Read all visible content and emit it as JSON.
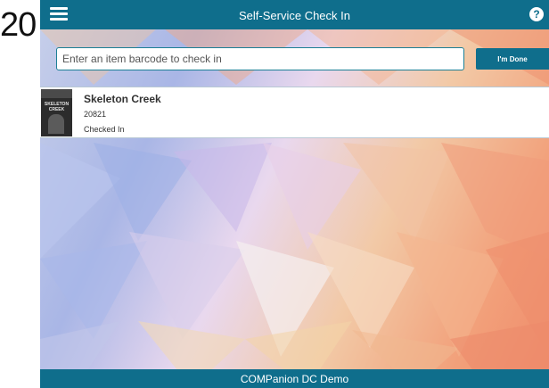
{
  "stray_text": "20",
  "header": {
    "title": "Self-Service Check In",
    "menu_icon": "hamburger-menu-icon",
    "help_icon": "help-icon",
    "help_glyph": "?"
  },
  "checkin": {
    "placeholder": "Enter an item barcode to check in",
    "value": "",
    "done_label": "I'm Done"
  },
  "items": [
    {
      "title": "Skeleton Creek",
      "barcode": "20821",
      "status": "Checked In",
      "cover_text": "SKELETON CREEK"
    }
  ],
  "footer": {
    "label": "COMPanion DC Demo"
  },
  "colors": {
    "brand": "#0f6e8c",
    "card_background": "#ffffff",
    "text": "#333333"
  }
}
